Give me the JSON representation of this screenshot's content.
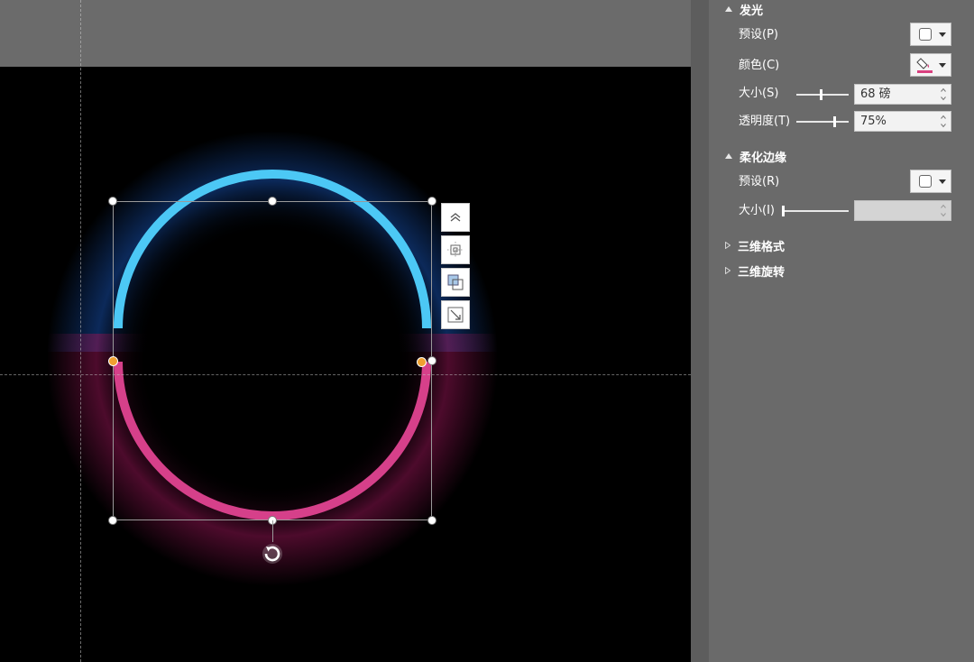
{
  "panel": {
    "glow": {
      "title": "发光",
      "preset_label": "预设(P)",
      "color_label": "颜色(C)",
      "size_label": "大小(S)",
      "size_value": "68 磅",
      "size_slider": 0.48,
      "transparency_label": "透明度(T)",
      "transparency_value": "75%",
      "transparency_slider": 0.75,
      "color_accent": "#d9407f"
    },
    "soft_edges": {
      "title": "柔化边缘",
      "preset_label": "预设(R)",
      "size_label": "大小(I)",
      "size_value": "",
      "size_slider": 0.0
    },
    "three_d_format": {
      "title": "三维格式"
    },
    "three_d_rotation": {
      "title": "三维旋转"
    }
  },
  "shape": {
    "top_arc_color": "#4cc8f5",
    "bottom_arc_color": "#d6408a",
    "top_glow_color": "#1a5cc8",
    "bottom_glow_color": "#8c1450"
  },
  "icons": {
    "layout_options": "layout-up-icon",
    "align": "align-center-icon",
    "arrange": "bring-forward-icon",
    "resize": "resize-icon",
    "rotate": "rotate-icon"
  }
}
